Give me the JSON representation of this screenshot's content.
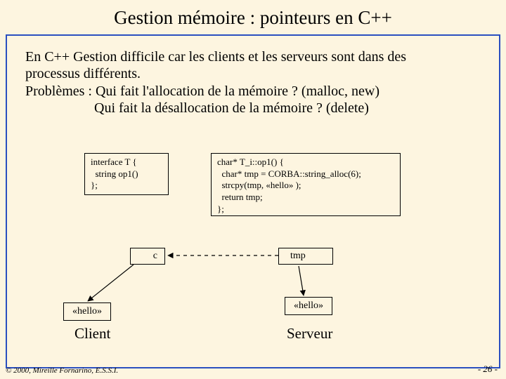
{
  "title": "Gestion mémoire : pointeurs en C++",
  "intro": {
    "line1": "En C++ Gestion difficile car les clients et les serveurs sont dans des",
    "line2": "processus différents.",
    "line3": "Problèmes : Qui fait l'allocation de la mémoire ?   (malloc, new)",
    "line4": "Qui fait la désallocation de la mémoire ? (delete)"
  },
  "code_left": "interface T {\n  string op1()\n};",
  "code_right": "char* T_i::op1() {\n  char* tmp = CORBA::string_alloc(6);\n  strcpy(tmp, «hello» );\n  return tmp;\n};",
  "boxes": {
    "c": "c",
    "tmp": "tmp",
    "hello_left": "«hello»",
    "hello_right": "«hello»"
  },
  "roles": {
    "client": "Client",
    "serveur": "Serveur"
  },
  "footer": {
    "copyright": "© 2000, Mireille Fornarino, E.S.S.I.",
    "page": "- 26 -"
  }
}
